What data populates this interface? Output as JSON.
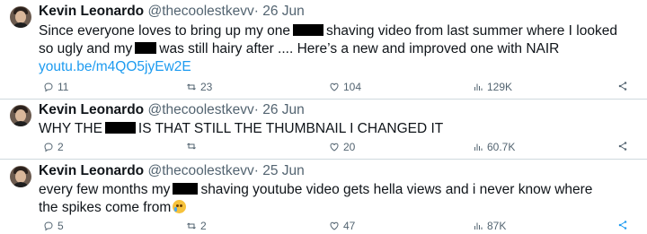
{
  "tweets": [
    {
      "name": "Kevin Leonardo",
      "handle": "@thecoolestkevv",
      "dot": "·",
      "date": "26 Jun",
      "line1_a": "Since everyone loves to bring up my one",
      "line1_b": "shaving video from last summer where I looked",
      "line2_a": "so ugly and my",
      "line2_b": "was still hairy after .... Here’s a new and improved one with NAIR",
      "link": "youtu.be/m4QO5jyEw2E",
      "replies": "11",
      "reposts": "23",
      "likes": "104",
      "views": "129K"
    },
    {
      "name": "Kevin Leonardo",
      "handle": "@thecoolestkevv",
      "dot": "·",
      "date": "26 Jun",
      "line1_a": "WHY THE",
      "line1_b": "IS THAT STILL THE THUMBNAIL I CHANGED IT",
      "replies": "2",
      "reposts": "",
      "likes": "20",
      "views": "60.7K"
    },
    {
      "name": "Kevin Leonardo",
      "handle": "@thecoolestkevv",
      "dot": "·",
      "date": "25 Jun",
      "line1_a": "every few months my",
      "line1_b": "shaving youtube video gets hella views and i never know where",
      "line2_a": "the spikes come from",
      "replies": "5",
      "reposts": "2",
      "likes": "47",
      "views": "87K"
    }
  ],
  "icons": {
    "reply": "reply-icon",
    "repost": "repost-icon",
    "like": "heart-icon",
    "views": "views-icon",
    "share": "share-icon"
  },
  "colors": {
    "text": "#0f1419",
    "secondary": "#536471",
    "link": "#1d9bf0",
    "divider": "#cfd9de"
  }
}
